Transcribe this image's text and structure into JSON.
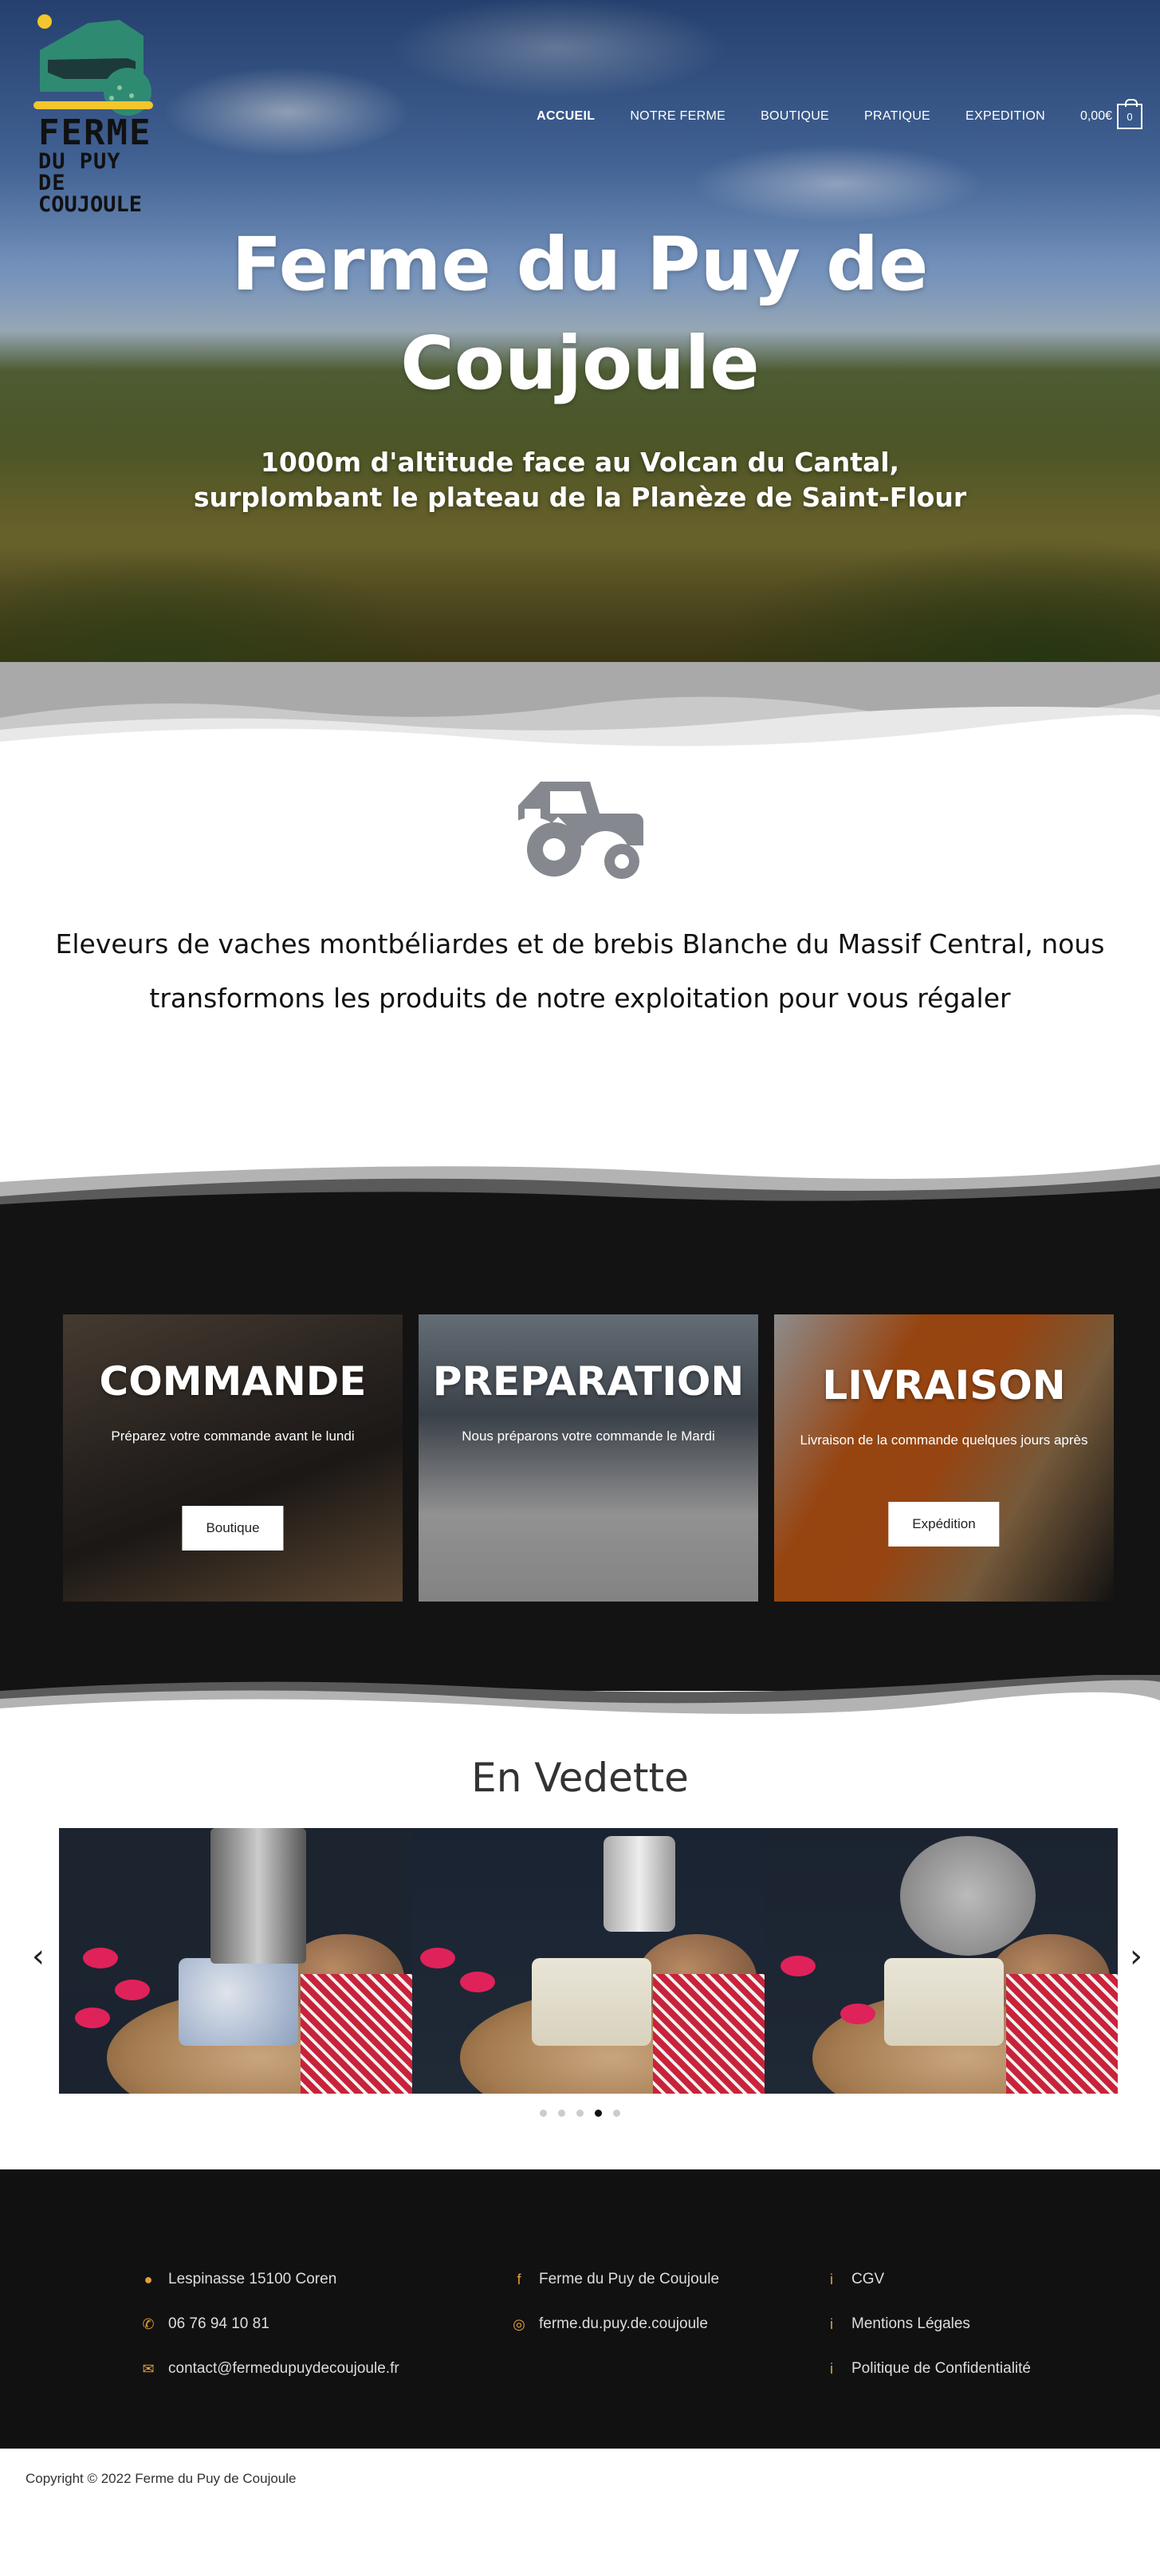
{
  "brand": {
    "logo_line1": "FERME",
    "logo_line2": "DU PUY DE",
    "logo_line3": "COUJOULE"
  },
  "nav": {
    "items": [
      "ACCUEIL",
      "NOTRE FERME",
      "BOUTIQUE",
      "PRATIQUE",
      "EXPEDITION"
    ],
    "active": "ACCUEIL",
    "cart_total": "0,00€",
    "cart_count": "0"
  },
  "hero": {
    "title_line1": "Ferme du Puy de",
    "title_line2": "Coujoule",
    "subtitle_line1": "1000m d'altitude face au Volcan du Cantal,",
    "subtitle_line2": "surplombant le plateau de la Planèze de Saint-Flour"
  },
  "intro": {
    "icon": "tractor-icon",
    "line1": "Eleveurs de vaches montbéliardes et de brebis Blanche du Massif Central, nous",
    "line2": "transformons les produits de notre exploitation pour vous régaler"
  },
  "steps": [
    {
      "title": "COMMANDE",
      "text": "Préparez votre commande avant le lundi",
      "button": "Boutique"
    },
    {
      "title": "PREPARATION",
      "text": "Nous préparons votre commande le Mardi",
      "button": ""
    },
    {
      "title": "LIVRAISON",
      "text": "Livraison de la commande quelques  jours après",
      "button": "Expédition"
    }
  ],
  "featured": {
    "title": "En Vedette",
    "slides": 3,
    "dots": 5,
    "active_dot": 4
  },
  "footer": {
    "address": "Lespinasse 15100 Coren",
    "phone": "06 76 94 10 81",
    "email": "contact@fermedupuydecoujoule.fr",
    "facebook": "Ferme du Puy de Coujoule",
    "instagram": "ferme.du.puy.de.coujoule",
    "cgv": "CGV",
    "legal": "Mentions Légales",
    "privacy": "Politique de Confidentialité",
    "accent_color": "#e1a13c"
  },
  "copyright": "Copyright © 2022 Ferme du Puy de Coujoule"
}
